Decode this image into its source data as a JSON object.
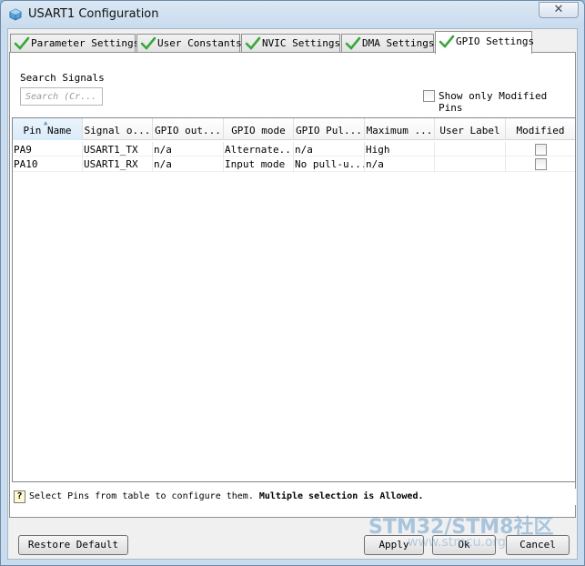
{
  "window": {
    "title": "USART1 Configuration",
    "close_label": "✕"
  },
  "tabs": [
    {
      "label": "Parameter Settings",
      "active": false
    },
    {
      "label": "User Constants",
      "active": false
    },
    {
      "label": "NVIC Settings",
      "active": false
    },
    {
      "label": "DMA Settings",
      "active": false
    },
    {
      "label": "GPIO Settings",
      "active": true
    }
  ],
  "search": {
    "label": "Search Signals",
    "placeholder": "Search (Cr..."
  },
  "filter": {
    "show_modified_label": "Show only Modified Pins",
    "checked": false
  },
  "table": {
    "sort_indicator": "▲",
    "columns": [
      "Pin Name",
      "Signal o...",
      "GPIO out...",
      "GPIO mode",
      "GPIO Pul...",
      "Maximum ...",
      "User Label",
      "Modified"
    ],
    "rows": [
      {
        "pin": "PA9",
        "signal": "USART1_TX",
        "output": "n/a",
        "mode": "Alternate...",
        "pull": "n/a",
        "speed": "High",
        "label": "",
        "modified": false
      },
      {
        "pin": "PA10",
        "signal": "USART1_RX",
        "output": "n/a",
        "mode": "Input mode",
        "pull": "No pull-u...",
        "speed": "n/a",
        "label": "",
        "modified": false
      }
    ]
  },
  "info": {
    "icon": "?",
    "text": "Select Pins from table to configure them.",
    "bold_text": "Multiple selection is Allowed."
  },
  "buttons": {
    "restore_default": "Restore Default",
    "apply": "Apply",
    "ok": "Ok",
    "cancel": "Cancel"
  },
  "watermark": {
    "line1": "STM32/STM8社区",
    "line2": "www.stmcu.org"
  },
  "colors": {
    "check_green": "#3aa63a",
    "titlebar": "#c9dcee",
    "accent": "#38d0ff"
  }
}
